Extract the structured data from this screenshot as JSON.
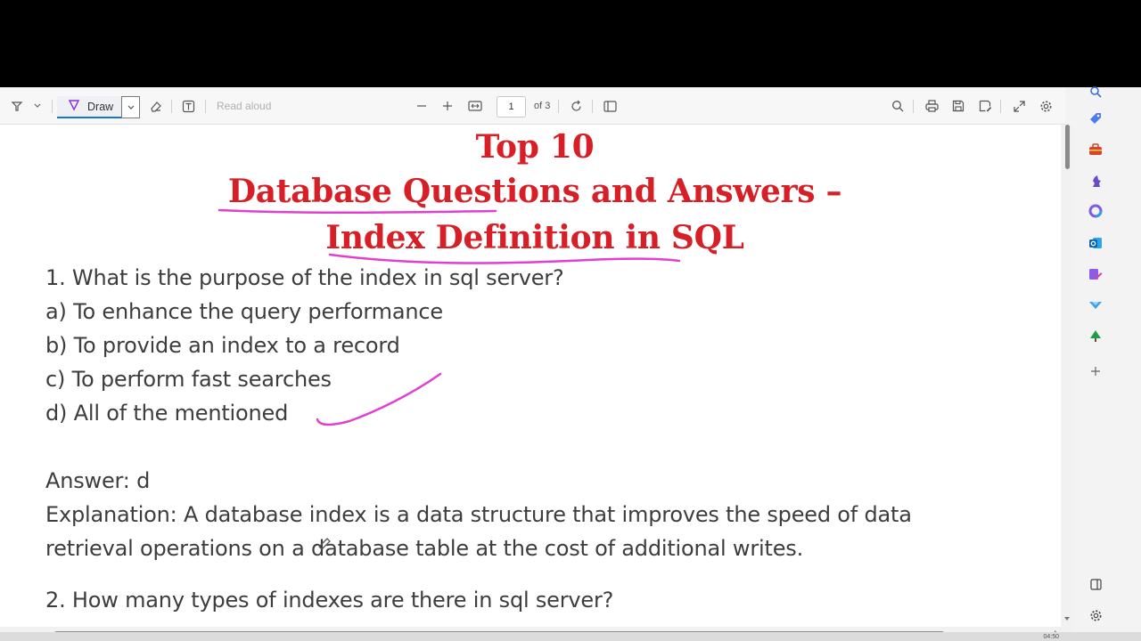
{
  "toolbar": {
    "draw_label": "Draw",
    "read_aloud_label": "Read aloud",
    "page_current": "1",
    "page_total": "of 3"
  },
  "document": {
    "title_line1": "Top 10",
    "title_line2": "Database Questions and Answers –",
    "title_line3": "Index Definition in SQL",
    "q1": "1. What is the purpose of the index in sql server?",
    "q1_a": "a) To enhance the query performance",
    "q1_b": "b) To provide an index to a record",
    "q1_c": "c) To perform fast searches",
    "q1_d": "d) All of the mentioned",
    "answer": "Answer: d",
    "explanation_1": "Explanation: A database index is a data structure that improves the speed of data",
    "explanation_2": "retrieval operations on a database table at the cost of additional writes.",
    "q2": "2. How many types of indexes are there in sql server?"
  },
  "colors": {
    "title_red": "#d61f26",
    "ink_pink": "#e040d0",
    "body_text": "#3d3d3d"
  },
  "taskbar": {
    "clock": "04:50"
  }
}
